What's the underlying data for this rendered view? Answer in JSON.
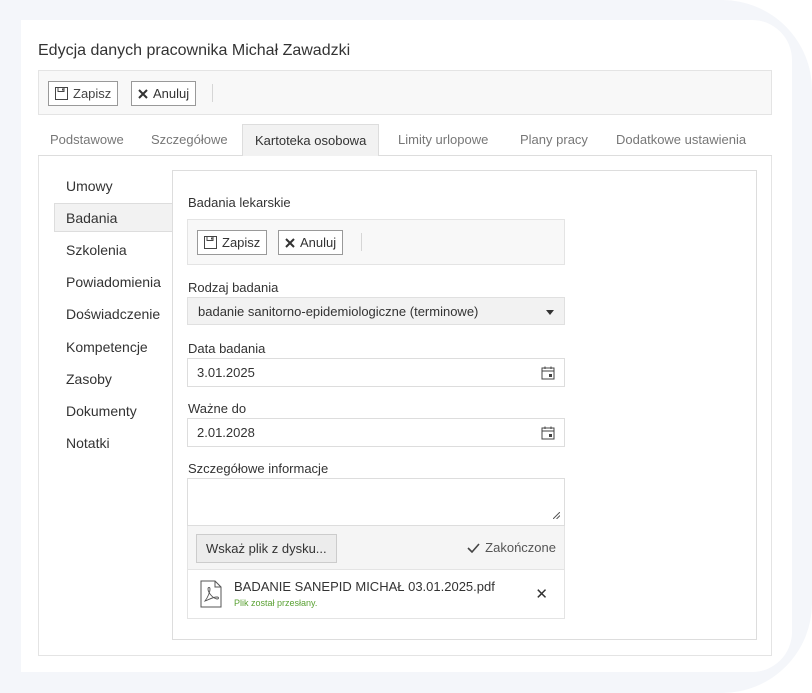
{
  "page": {
    "title": "Edycja danych pracownika Michał Zawadzki"
  },
  "toolbar": {
    "save_label": "Zapisz",
    "cancel_label": "Anuluj"
  },
  "tabs": [
    {
      "label": "Podstawowe"
    },
    {
      "label": "Szczegółowe"
    },
    {
      "label": "Kartoteka osobowa",
      "active": true
    },
    {
      "label": "Limity urlopowe"
    },
    {
      "label": "Plany pracy"
    },
    {
      "label": "Dodatkowe ustawienia"
    }
  ],
  "sidebar": {
    "items": [
      {
        "label": "Umowy"
      },
      {
        "label": "Badania",
        "active": true
      },
      {
        "label": "Szkolenia"
      },
      {
        "label": "Powiadomienia"
      },
      {
        "label": "Doświadczenie"
      },
      {
        "label": "Kompetencje"
      },
      {
        "label": "Zasoby"
      },
      {
        "label": "Dokumenty"
      },
      {
        "label": "Notatki"
      }
    ]
  },
  "section": {
    "title": "Badania lekarskie",
    "save_label": "Zapisz",
    "cancel_label": "Anuluj"
  },
  "form": {
    "exam_type": {
      "label": "Rodzaj badania",
      "value": "badanie sanitorno-epidemiologiczne (terminowe)"
    },
    "exam_date": {
      "label": "Data badania",
      "value": "3.01.2025"
    },
    "valid_until": {
      "label": "Ważne do",
      "value": "2.01.2028"
    },
    "details": {
      "label": "Szczegółowe informacje",
      "value": ""
    }
  },
  "upload": {
    "button_label": "Wskaż plik z dysku...",
    "status": "Zakończone",
    "file_name": "BADANIE SANEPID MICHAŁ 03.01.2025.pdf",
    "file_status": "Plik został przesłany."
  },
  "colors": {
    "success": "#5aa133",
    "border": "#dddddd",
    "active_tab_bg": "#f2f2f2"
  }
}
